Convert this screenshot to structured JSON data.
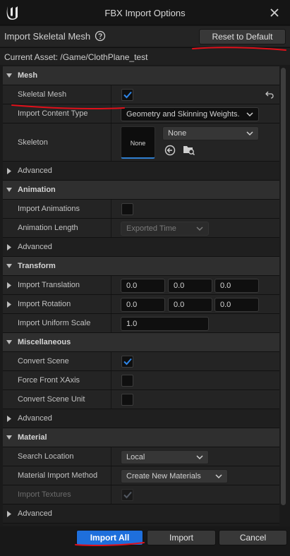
{
  "window": {
    "title": "FBX Import Options",
    "logo_icon": "unreal-engine-logo",
    "close_icon": "close-icon"
  },
  "header": {
    "section_title": "Import Skeletal Mesh",
    "help_icon": "help-circle-icon",
    "reset_button": "Reset to Default"
  },
  "asset": {
    "label": "Current Asset:  /Game/ClothPlane_test"
  },
  "sections": {
    "mesh": {
      "title": "Mesh",
      "skeletal_mesh": {
        "label": "Skeletal Mesh",
        "checked": true
      },
      "import_content_type": {
        "label": "Import Content Type",
        "value": "Geometry and Skinning Weights."
      },
      "skeleton": {
        "label": "Skeleton",
        "thumbnail": "None",
        "value": "None"
      },
      "advanced": "Advanced"
    },
    "animation": {
      "title": "Animation",
      "import_animations": {
        "label": "Import Animations",
        "checked": false
      },
      "animation_length": {
        "label": "Animation Length",
        "value": "Exported Time"
      },
      "advanced": "Advanced"
    },
    "transform": {
      "title": "Transform",
      "import_translation": {
        "label": "Import Translation",
        "x": "0.0",
        "y": "0.0",
        "z": "0.0"
      },
      "import_rotation": {
        "label": "Import Rotation",
        "x": "0.0",
        "y": "0.0",
        "z": "0.0"
      },
      "import_uniform_scale": {
        "label": "Import Uniform Scale",
        "value": "1.0"
      }
    },
    "miscellaneous": {
      "title": "Miscellaneous",
      "convert_scene": {
        "label": "Convert Scene",
        "checked": true
      },
      "force_front_xaxis": {
        "label": "Force Front XAxis",
        "checked": false
      },
      "convert_scene_unit": {
        "label": "Convert Scene Unit",
        "checked": false
      },
      "advanced": "Advanced"
    },
    "material": {
      "title": "Material",
      "search_location": {
        "label": "Search Location",
        "value": "Local"
      },
      "material_import_method": {
        "label": "Material Import Method",
        "value": "Create New Materials"
      },
      "import_textures": {
        "label": "Import Textures",
        "checked": true,
        "enabled": false
      },
      "advanced": "Advanced"
    }
  },
  "footer": {
    "import_all": "Import All",
    "import": "Import",
    "cancel": "Cancel"
  },
  "colors": {
    "accent": "#1e6fdc",
    "annotation": "#e0101a",
    "check": "#2f86e8"
  }
}
